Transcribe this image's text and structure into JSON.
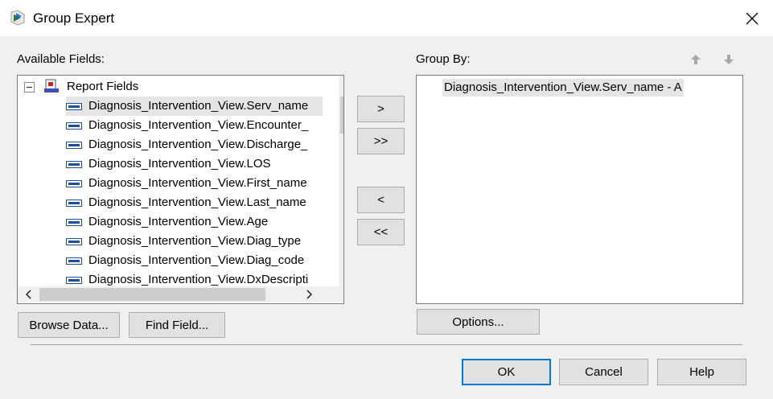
{
  "window": {
    "title": "Group Expert",
    "close_icon": "close-icon",
    "app_icon": "crystal-reports-icon"
  },
  "available_fields": {
    "label": "Available Fields:",
    "root": "Report Fields",
    "items": [
      "Diagnosis_Intervention_View.Serv_name",
      "Diagnosis_Intervention_View.Encounter_",
      "Diagnosis_Intervention_View.Discharge_",
      "Diagnosis_Intervention_View.LOS",
      "Diagnosis_Intervention_View.First_name",
      "Diagnosis_Intervention_View.Last_name",
      "Diagnosis_Intervention_View.Age",
      "Diagnosis_Intervention_View.Diag_type",
      "Diagnosis_Intervention_View.Diag_code",
      "Diagnosis_Intervention_View.DxDescripti"
    ]
  },
  "transfer_buttons": {
    "add": ">",
    "add_all": ">>",
    "remove": "<",
    "remove_all": "<<"
  },
  "group_by": {
    "label": "Group By:",
    "items": [
      "Diagnosis_Intervention_View.Serv_name - A"
    ],
    "move_up_icon": "arrow-up-icon",
    "move_down_icon": "arrow-down-icon"
  },
  "buttons": {
    "browse_data": "Browse Data...",
    "find_field": "Find Field...",
    "options": "Options...",
    "ok": "OK",
    "cancel": "Cancel",
    "help": "Help"
  },
  "colors": {
    "default_button_border": "#0078d7",
    "selection": "#e5e5e5",
    "field_icon": "#1f4e9c"
  }
}
